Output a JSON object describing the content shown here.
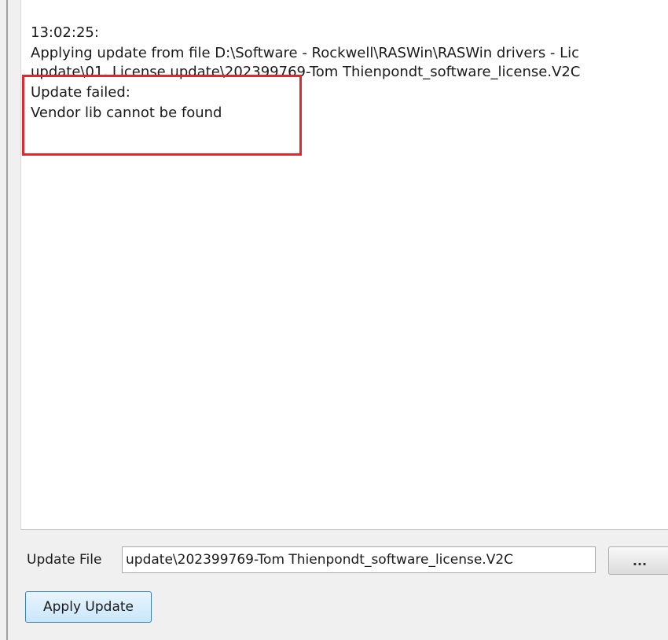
{
  "log": {
    "lines": [
      "13:02:25:",
      "Applying update from file D:\\Software - Rockwell\\RASWin\\RASWin drivers - Lic",
      "update\\01. License update\\202399769-Tom Thienpondt_software_license.V2C",
      "Update failed:",
      "Vendor lib cannot be found"
    ],
    "highlight_color": "#e0282e"
  },
  "update_file": {
    "label": "Update File",
    "value": "update\\202399769-Tom Thienpondt_software_license.V2C",
    "browse_label": "..."
  },
  "actions": {
    "apply_label": "Apply Update"
  }
}
